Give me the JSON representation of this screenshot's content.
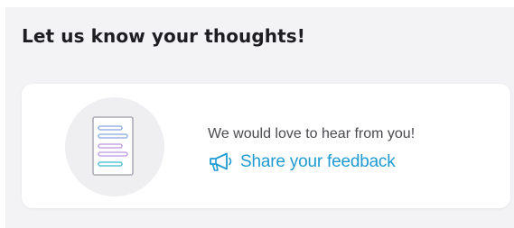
{
  "section": {
    "heading": "Let us know your thoughts!"
  },
  "feedback_card": {
    "illustration_icon": "document-chat-icon",
    "message": "We would love to hear from you!",
    "cta_icon": "megaphone-icon",
    "cta_label": "Share your feedback"
  },
  "colors": {
    "accent": "#1f9bd1",
    "heading": "#1e1e22",
    "panel_background": "#f3f2f4",
    "card_background": "#ffffff",
    "doc_line_blue": "#9bb6e8",
    "doc_line_purple": "#c7a9e6",
    "doc_line_teal": "#5fc6d6"
  }
}
